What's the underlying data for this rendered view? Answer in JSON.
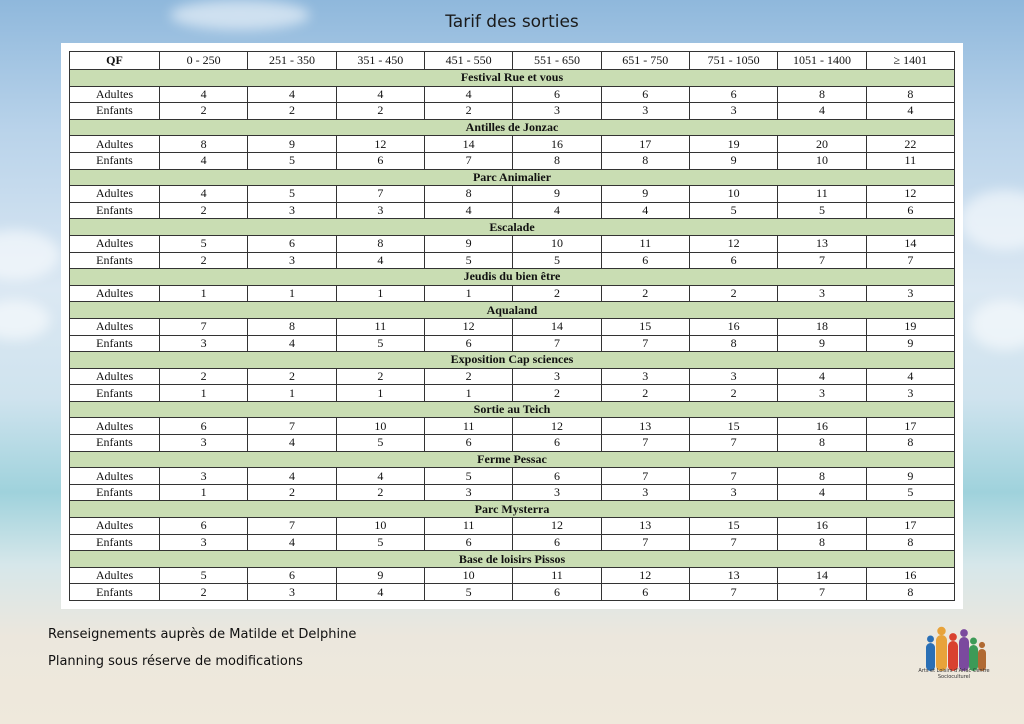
{
  "title": "Tarif des sorties",
  "table": {
    "headers": [
      "QF",
      "0 - 250",
      "251 - 350",
      "351 - 450",
      "451 - 550",
      "551 - 650",
      "651 - 750",
      "751 - 1050",
      "1051 - 1400",
      "≥ 1401"
    ],
    "sections": [
      {
        "name": "Festival Rue et vous",
        "rows": [
          {
            "label": "Adultes",
            "values": [
              "4",
              "4",
              "4",
              "4",
              "6",
              "6",
              "6",
              "8",
              "8"
            ]
          },
          {
            "label": "Enfants",
            "values": [
              "2",
              "2",
              "2",
              "2",
              "3",
              "3",
              "3",
              "4",
              "4"
            ]
          }
        ]
      },
      {
        "name": "Antilles de Jonzac",
        "rows": [
          {
            "label": "Adultes",
            "values": [
              "8",
              "9",
              "12",
              "14",
              "16",
              "17",
              "19",
              "20",
              "22"
            ]
          },
          {
            "label": "Enfants",
            "values": [
              "4",
              "5",
              "6",
              "7",
              "8",
              "8",
              "9",
              "10",
              "11"
            ]
          }
        ]
      },
      {
        "name": "Parc Animalier",
        "rows": [
          {
            "label": "Adultes",
            "values": [
              "4",
              "5",
              "7",
              "8",
              "9",
              "9",
              "10",
              "11",
              "12"
            ]
          },
          {
            "label": "Enfants",
            "values": [
              "2",
              "3",
              "3",
              "4",
              "4",
              "4",
              "5",
              "5",
              "6"
            ]
          }
        ]
      },
      {
        "name": "Escalade",
        "rows": [
          {
            "label": "Adultes",
            "values": [
              "5",
              "6",
              "8",
              "9",
              "10",
              "11",
              "12",
              "13",
              "14"
            ]
          },
          {
            "label": "Enfants",
            "values": [
              "2",
              "3",
              "4",
              "5",
              "5",
              "6",
              "6",
              "7",
              "7"
            ]
          }
        ]
      },
      {
        "name": "Jeudis du bien être",
        "rows": [
          {
            "label": "Adultes",
            "values": [
              "1",
              "1",
              "1",
              "1",
              "2",
              "2",
              "2",
              "3",
              "3"
            ]
          }
        ]
      },
      {
        "name": "Aqualand",
        "rows": [
          {
            "label": "Adultes",
            "values": [
              "7",
              "8",
              "11",
              "12",
              "14",
              "15",
              "16",
              "18",
              "19"
            ]
          },
          {
            "label": "Enfants",
            "values": [
              "3",
              "4",
              "5",
              "6",
              "7",
              "7",
              "8",
              "9",
              "9"
            ]
          }
        ]
      },
      {
        "name": "Exposition Cap sciences",
        "rows": [
          {
            "label": "Adultes",
            "values": [
              "2",
              "2",
              "2",
              "2",
              "3",
              "3",
              "3",
              "4",
              "4"
            ]
          },
          {
            "label": "Enfants",
            "values": [
              "1",
              "1",
              "1",
              "1",
              "2",
              "2",
              "2",
              "3",
              "3"
            ]
          }
        ]
      },
      {
        "name": "Sortie au Teich",
        "rows": [
          {
            "label": "Adultes",
            "values": [
              "6",
              "7",
              "10",
              "11",
              "12",
              "13",
              "15",
              "16",
              "17"
            ]
          },
          {
            "label": "Enfants",
            "values": [
              "3",
              "4",
              "5",
              "6",
              "6",
              "7",
              "7",
              "8",
              "8"
            ]
          }
        ]
      },
      {
        "name": "Ferme Pessac",
        "rows": [
          {
            "label": "Adultes",
            "values": [
              "3",
              "4",
              "4",
              "5",
              "6",
              "7",
              "7",
              "8",
              "9"
            ]
          },
          {
            "label": "Enfants",
            "values": [
              "1",
              "2",
              "2",
              "3",
              "3",
              "3",
              "3",
              "4",
              "5"
            ]
          }
        ]
      },
      {
        "name": "Parc Mysterra",
        "rows": [
          {
            "label": "Adultes",
            "values": [
              "6",
              "7",
              "10",
              "11",
              "12",
              "13",
              "15",
              "16",
              "17"
            ]
          },
          {
            "label": "Enfants",
            "values": [
              "3",
              "4",
              "5",
              "6",
              "6",
              "7",
              "7",
              "8",
              "8"
            ]
          }
        ]
      },
      {
        "name": "Base de loisirs Pissos",
        "rows": [
          {
            "label": "Adultes",
            "values": [
              "5",
              "6",
              "9",
              "10",
              "11",
              "12",
              "13",
              "14",
              "16"
            ]
          },
          {
            "label": "Enfants",
            "values": [
              "2",
              "3",
              "4",
              "5",
              "6",
              "6",
              "7",
              "7",
              "8"
            ]
          }
        ]
      }
    ]
  },
  "footer": {
    "line1": "Renseignements auprès de Matilde et Delphine",
    "line2": "Planning sous réserve de modifications"
  },
  "logo": {
    "text": "Arts et Loisirs d'Arlac Centre Socioculturel",
    "colors": [
      "#2a6fb5",
      "#e8a33a",
      "#d9412f",
      "#7b4a9e",
      "#3d9a57",
      "#b06a33"
    ]
  },
  "colors": {
    "section_band": "#c9ddb3"
  }
}
